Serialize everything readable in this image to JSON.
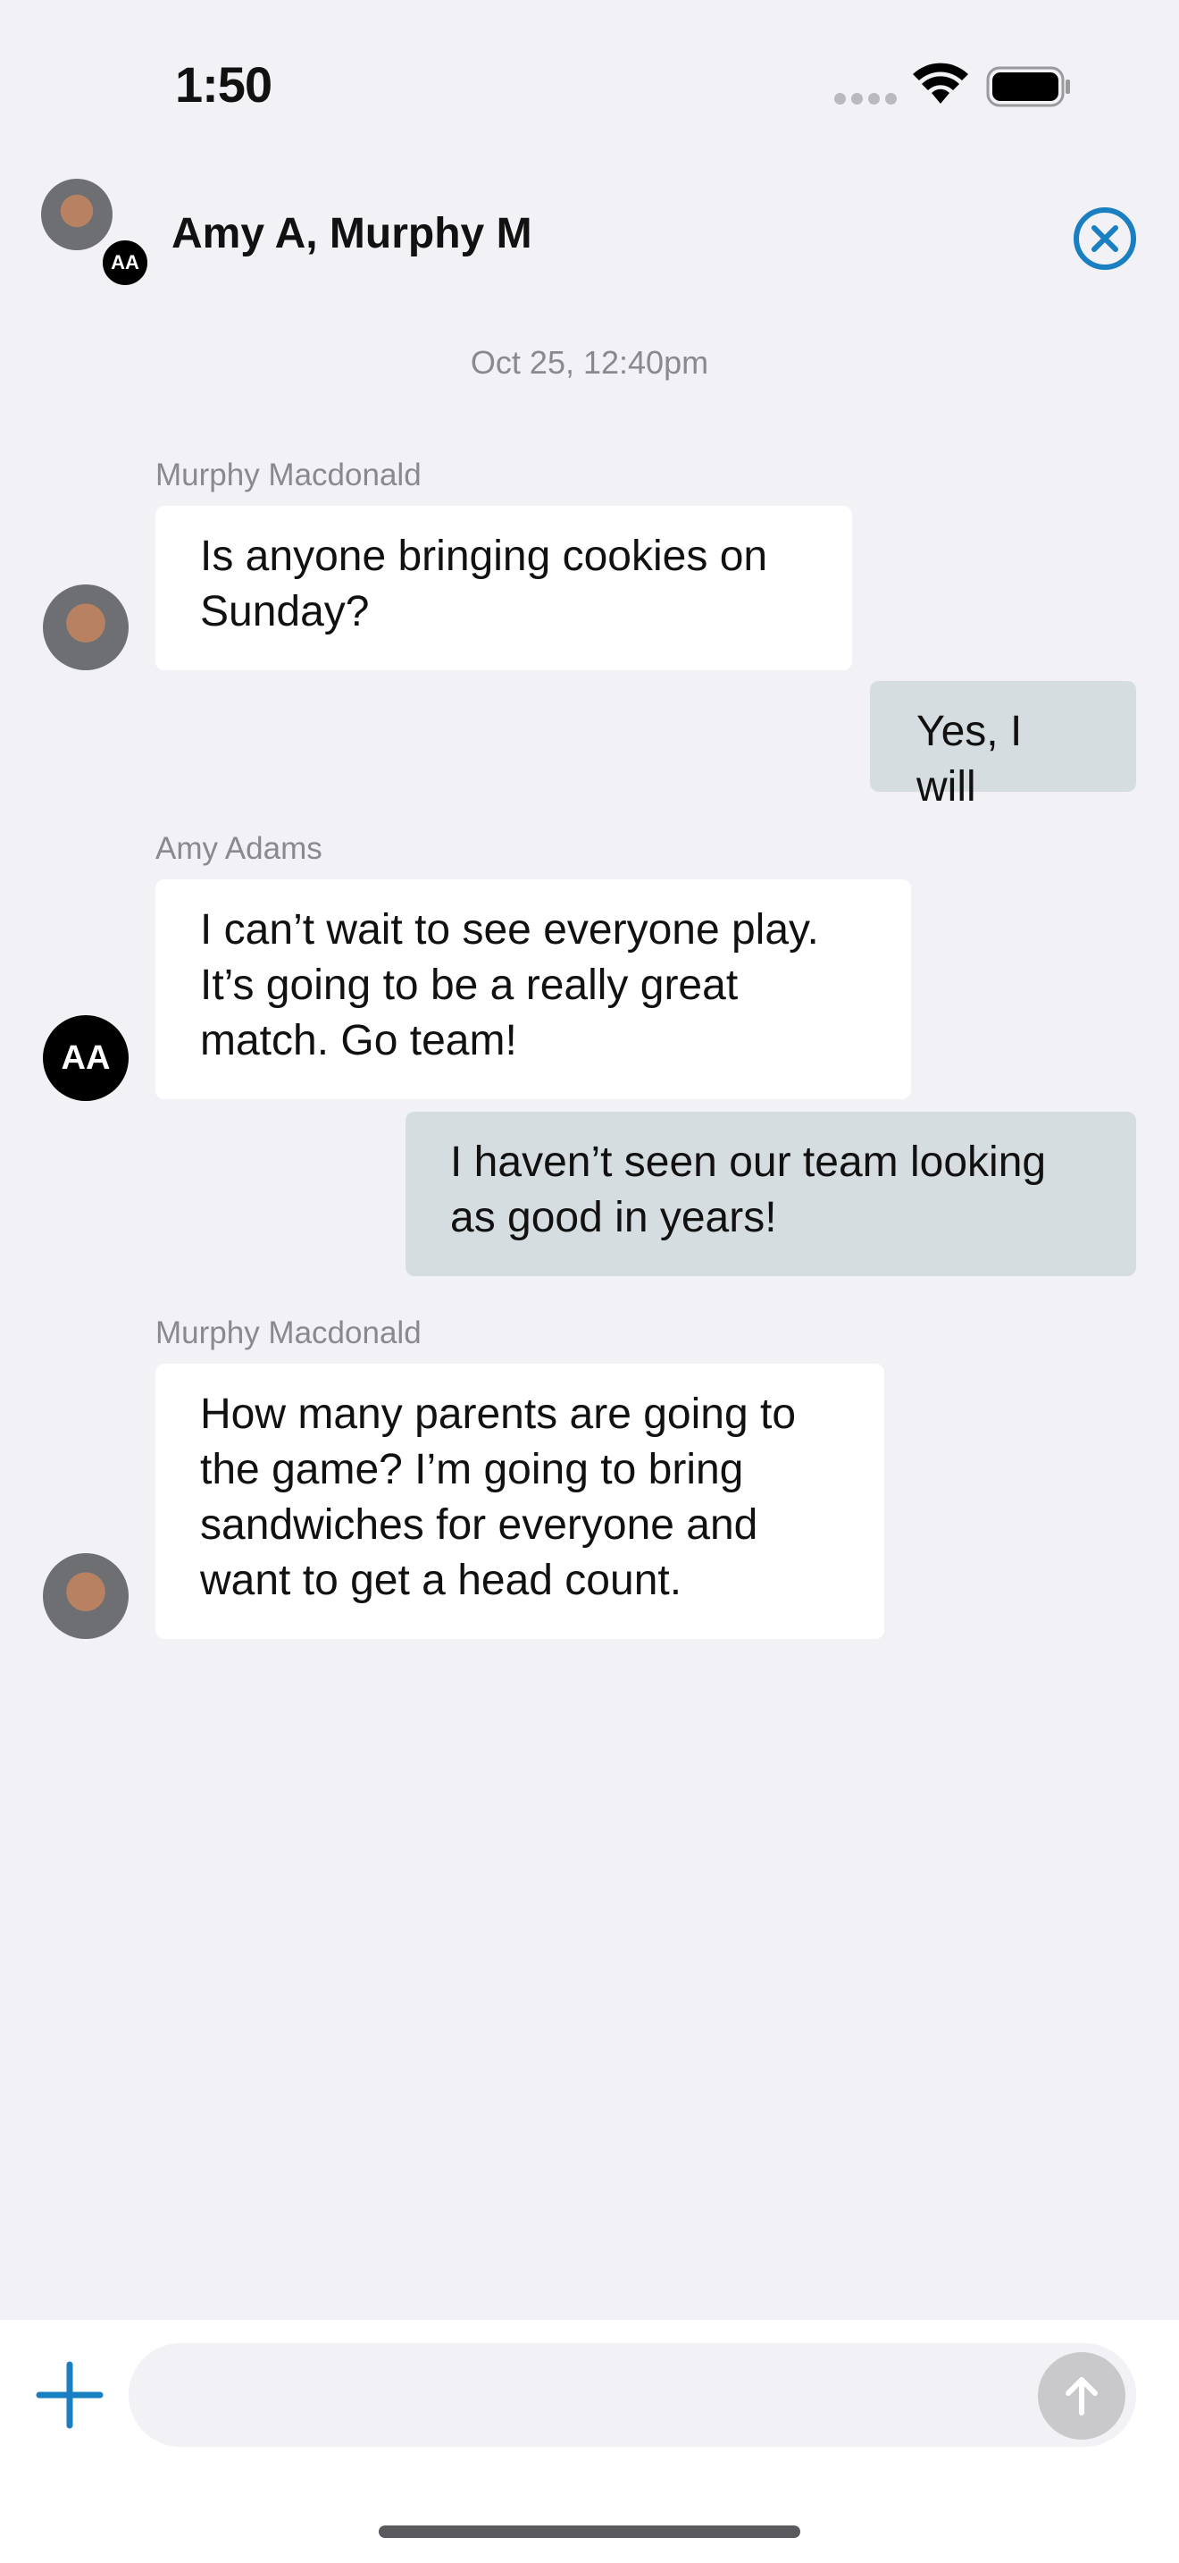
{
  "status_bar": {
    "time": "1:50",
    "signal_icon": "cellular-dots-icon",
    "wifi_icon": "wifi-icon",
    "battery_icon": "battery-icon"
  },
  "header": {
    "title": "Amy A, Murphy M",
    "avatar_initials": "AA",
    "close_icon": "close-circle-icon",
    "accent_color": "#1a7fc1"
  },
  "conversation": {
    "timestamp": "Oct 25, 12:40pm",
    "messages": [
      {
        "sender": "Murphy Macdonald",
        "direction": "incoming",
        "avatar": "photo",
        "text_lines": [
          "Is anyone bringing cookies on",
          "Sunday?"
        ]
      },
      {
        "sender": "",
        "direction": "outgoing",
        "text_lines": [
          "Yes, I will"
        ]
      },
      {
        "sender": "Amy Adams",
        "direction": "incoming",
        "avatar": "AA",
        "text_lines": [
          "I can’t wait to see everyone play.",
          "It’s going to be a really great",
          "match. Go team!"
        ]
      },
      {
        "sender": "",
        "direction": "outgoing",
        "text_lines": [
          "I haven’t seen our team looking",
          "as good in years!"
        ]
      },
      {
        "sender": "Murphy Macdonald",
        "direction": "incoming",
        "avatar": "photo",
        "text_lines": [
          "How many parents are going to",
          "the game? I’m going to bring",
          "sandwiches for everyone and",
          "want to get a head count."
        ]
      }
    ]
  },
  "composer": {
    "placeholder": "",
    "add_icon": "plus-icon",
    "send_icon": "arrow-up-icon"
  }
}
